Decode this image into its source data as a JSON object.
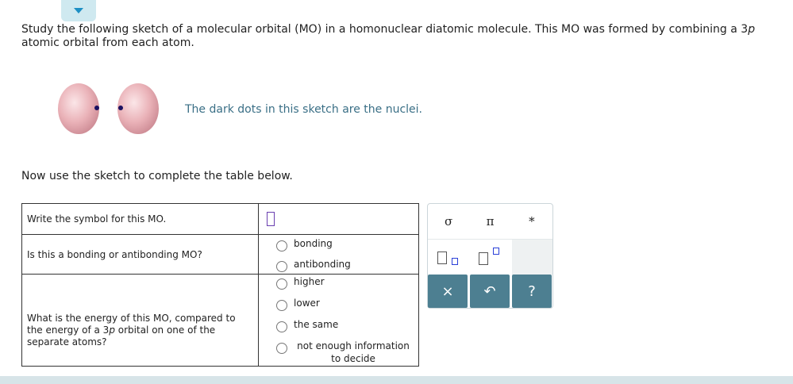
{
  "question": {
    "text_part1": "Study the following sketch of a molecular orbital (MO) in a homonuclear diatomic molecule. This MO was formed by combining a 3",
    "text_italic": "p",
    "text_part2": "atomic orbital from each atom."
  },
  "sketch": {
    "caption": "The dark dots in this sketch are the nuclei."
  },
  "instruction": "Now use the sketch to complete the table below.",
  "table": {
    "row1_question": "Write the symbol for this MO.",
    "row2_question": "Is this a bonding or antibonding MO?",
    "row2_options": [
      "bonding",
      "antibonding"
    ],
    "row3_question_a": "What is the energy of this MO, compared to the energy of a 3",
    "row3_question_italic": "p",
    "row3_question_b": " orbital on one of the separate atoms?",
    "row3_options": [
      "higher",
      "lower",
      "the same",
      "not enough information to decide"
    ]
  },
  "palette": {
    "symbols": [
      "σ",
      "π",
      "*"
    ],
    "buttons": {
      "clear": "×",
      "undo": "↶",
      "help": "?"
    }
  },
  "colors": {
    "caption": "#3a6f86",
    "palette_button": "#4d7f91",
    "answer_box": "#6a3fb0",
    "tab": "#cfe9f0",
    "tab_arrow": "#1d8fc4"
  }
}
